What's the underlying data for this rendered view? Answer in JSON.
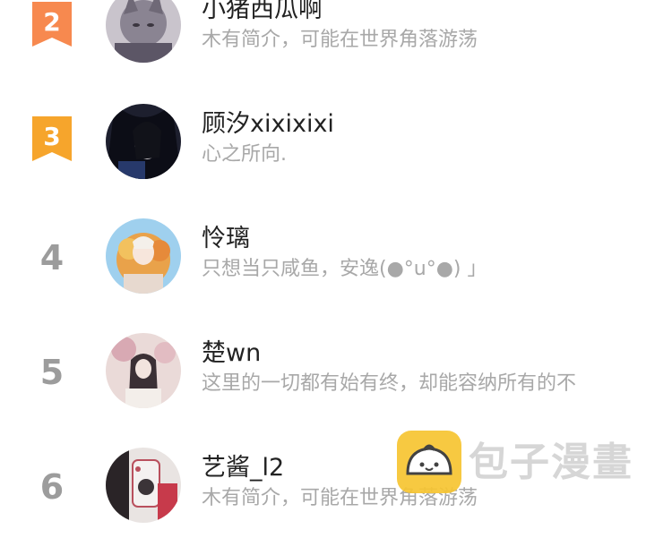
{
  "ranking": [
    {
      "rank": "2",
      "name": "小猪西瓜啊",
      "bio": "木有简介，可能在世界角落游荡",
      "badge_color": "#f7894f"
    },
    {
      "rank": "3",
      "name": "顾汐xixixixi",
      "bio": "心之所向.",
      "badge_color": "#f6a52c"
    },
    {
      "rank": "4",
      "name": "怜璃",
      "bio": "只想当只咸鱼，安逸(●°u°●)​ 」"
    },
    {
      "rank": "5",
      "name": "楚wn",
      "bio": "这里的一切都有始有终，却能容纳所有的不"
    },
    {
      "rank": "6",
      "name": "艺酱_l2",
      "bio": "木有简介，可能在世界角落游荡"
    }
  ],
  "watermark": {
    "text": "包子漫畫",
    "logo_color": "#f7c531"
  },
  "colors": {
    "name": "#222222",
    "bio": "#a8a8a8",
    "rank_number": "#9c9c9c"
  }
}
